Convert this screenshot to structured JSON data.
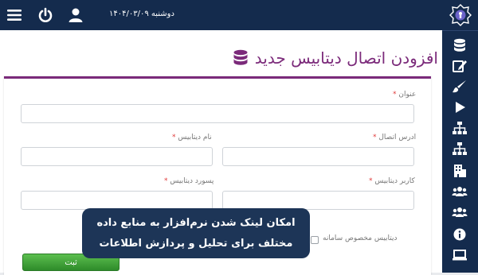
{
  "topbar": {
    "date": "دوشنبه ۱۴۰۴/۰۳/۰۹",
    "icons": [
      "menu-icon",
      "power-icon",
      "user-icon"
    ]
  },
  "sidebar": {
    "logo": "app-logo",
    "items": [
      "database-icon",
      "edit-icon",
      "brush-icon",
      "play-icon",
      "sitemap-icon",
      "sitemap-alt-icon",
      "building-icon",
      "users-icon",
      "users-alt-icon",
      "info-icon",
      "laptop-icon"
    ]
  },
  "page": {
    "title": "افزودن اتصال دیتابیس جدید"
  },
  "form": {
    "required_mark": "*",
    "title_label": "عنوان",
    "address_label": "ادرس اتصال",
    "db_name_label": "نام دیتابیس",
    "db_user_label": "کاربر دیتابیس",
    "db_password_label": "پسورد دیتابیس",
    "system_db_label": "دیتابیس مخصوص سامانه",
    "submit_label": "ثبت"
  },
  "tooltip": {
    "line1": "امکان لینک شدن نرم‌افزار به منابع داده",
    "line2": "مختلف برای تحلیل و پردازش اطلاعات"
  },
  "colors": {
    "dark_navy": "#142b4d",
    "accent_purple": "#7b2a7a",
    "required_red": "#e03a3a",
    "submit_green": "#3ea535"
  }
}
